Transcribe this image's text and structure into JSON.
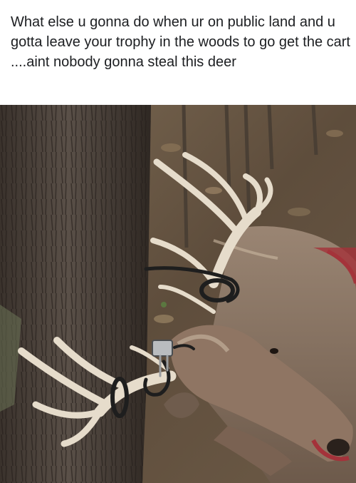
{
  "post": {
    "caption": "What else u gonna do when ur on public land and u gotta leave your trophy in the woods to go get the cart ....aint nobody gonna steal this deer"
  },
  "photo": {
    "subject_icons": [
      "tree-trunk-icon",
      "deer-antlers-icon",
      "cable-lock-icon",
      "forest-floor-leaves-icon"
    ],
    "colors": {
      "bark": "#4b4139",
      "leaves": "#6e5a45",
      "fur": "#8a7462",
      "antler": "#e6dccb",
      "lock_cable": "#1e1e1e",
      "blood": "#a4323a"
    }
  }
}
